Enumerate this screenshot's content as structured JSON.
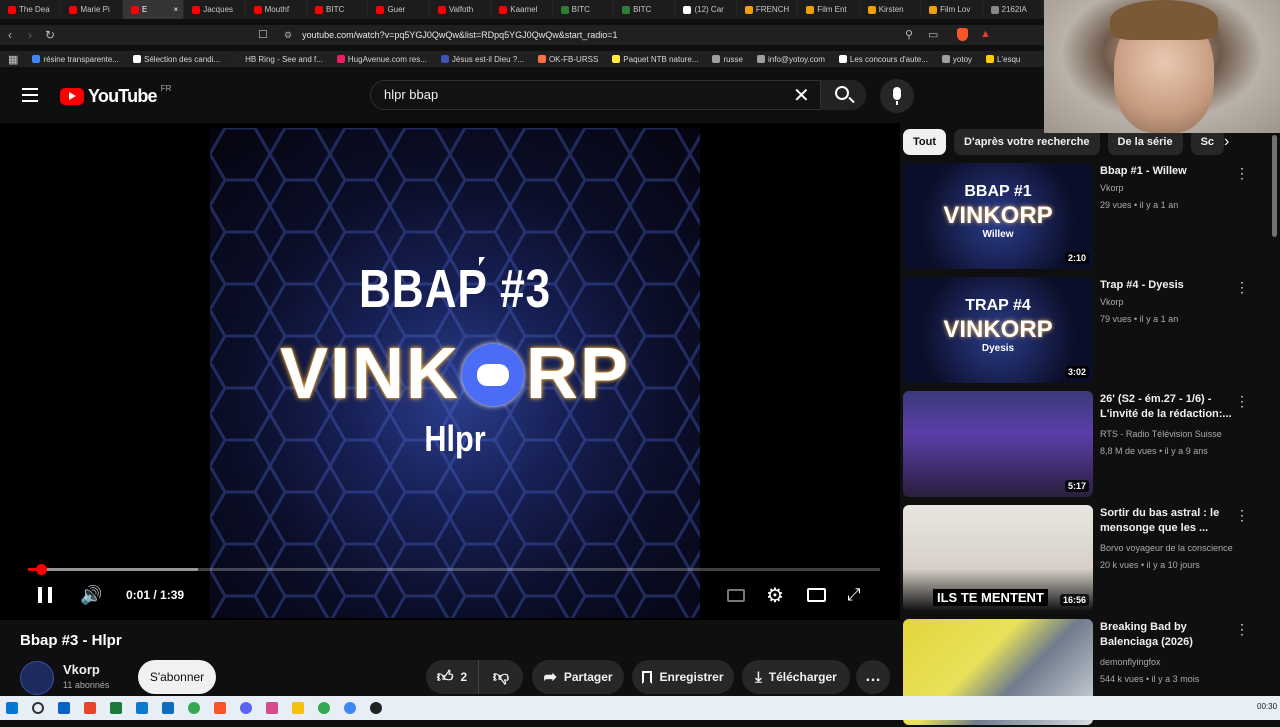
{
  "browser": {
    "tabs": [
      {
        "label": "The Dea",
        "color": "#ff0000"
      },
      {
        "label": "Marie Pi",
        "color": "#ff0000"
      },
      {
        "label": "E",
        "color": "#ff0000"
      },
      {
        "label": "Jacques",
        "color": "#ff0000"
      },
      {
        "label": "Mouthf",
        "color": "#ff0000"
      },
      {
        "label": "BITC",
        "color": "#ff0000"
      },
      {
        "label": "Guer",
        "color": "#ff0000"
      },
      {
        "label": "Valfoth",
        "color": "#ff0000"
      },
      {
        "label": "Kaamel",
        "color": "#ff0000"
      },
      {
        "label": "BITC",
        "color": "#2e7d32"
      },
      {
        "label": "BITC",
        "color": "#2e7d32"
      },
      {
        "label": "(12) Car",
        "color": "#ffffff"
      },
      {
        "label": "FRENCH",
        "color": "#f59e0b"
      },
      {
        "label": "Film Ent",
        "color": "#f59e0b"
      },
      {
        "label": "Kirsten",
        "color": "#f59e0b"
      },
      {
        "label": "Film Lov",
        "color": "#f59e0b"
      },
      {
        "label": "2162IA",
        "color": "#888888"
      }
    ],
    "url": "youtube.com/watch?v=pq5YGJ0QwQw&list=RDpq5YGJ0QwQw&start_radio=1",
    "bookmarks": [
      {
        "label": "résine transparente...",
        "color": "#4285f4"
      },
      {
        "label": "Sélection des candi...",
        "color": "#ffffff"
      },
      {
        "label": "HB Ring - See and f...",
        "color": "#222222"
      },
      {
        "label": "HugAvenue.com res...",
        "color": "#e91e63"
      },
      {
        "label": "Jésus est-il Dieu ?...",
        "color": "#3f51b5"
      },
      {
        "label": "OK-FB-URSS",
        "color": "#ff7043"
      },
      {
        "label": "Paquet NTB nature...",
        "color": "#ffeb3b"
      },
      {
        "label": "russe",
        "color": "#9e9e9e"
      },
      {
        "label": "info@yotoy.com",
        "color": "#9e9e9e"
      },
      {
        "label": "Les concours d'aute...",
        "color": "#ffffff"
      },
      {
        "label": "yotoy",
        "color": "#9e9e9e"
      },
      {
        "label": "L'esqu",
        "color": "#ffcc00"
      }
    ]
  },
  "youtube": {
    "logo_text": "YouTube",
    "region": "FR",
    "search_query": "hlpr bbap"
  },
  "player": {
    "thumb_line1": "BBAP #3",
    "thumb_line2_a": "VINK",
    "thumb_line2_b": "RP",
    "thumb_line3": "Hlpr",
    "time": "0:01 / 1:39",
    "progress_fraction": 0.0101,
    "buffered_fraction": 0.2
  },
  "video": {
    "title": "Bbap #3 - Hlpr",
    "channel": "Vkorp",
    "subscribers": "11 abonnés",
    "subscribe_label": "S'abonner",
    "likes": "2",
    "share_label": "Partager",
    "save_label": "Enregistrer",
    "download_label": "Télécharger"
  },
  "sidebar": {
    "chips": [
      "Tout",
      "D'après votre recherche",
      "De la série",
      "Sc"
    ],
    "recommendations": [
      {
        "title": "Bbap #1 - Willew",
        "channel": "Vkorp",
        "meta": "29 vues • il y a 1 an",
        "duration": "2:10",
        "thumb_top": "BBAP #1",
        "thumb_bottom": "Willew"
      },
      {
        "title": "Trap #4 - Dyesis",
        "channel": "Vkorp",
        "meta": "79 vues • il y a 1 an",
        "duration": "3:02",
        "thumb_top": "TRAP #4",
        "thumb_bottom": "Dyesis"
      },
      {
        "title": "26' (S2 - ém.27 - 1/6) - L'invité de la rédaction:...",
        "channel": "RTS - Radio Télévision Suisse",
        "meta": "8,8 M de vues • il y a 9 ans",
        "duration": "5:17"
      },
      {
        "title": "Sortir du bas astral : le mensonge que les ...",
        "channel": "Borvo voyageur de la conscience",
        "meta": "20 k vues • il y a 10 jours",
        "duration": "16:56",
        "thumb_caption": "ILS TE MENTENT"
      },
      {
        "title": "Breaking Bad by Balenciaga (2026)",
        "channel": "demonflyingfox",
        "meta": "544 k vues • il y a 3 mois"
      }
    ]
  },
  "taskbar": {
    "clock": "00:30"
  }
}
